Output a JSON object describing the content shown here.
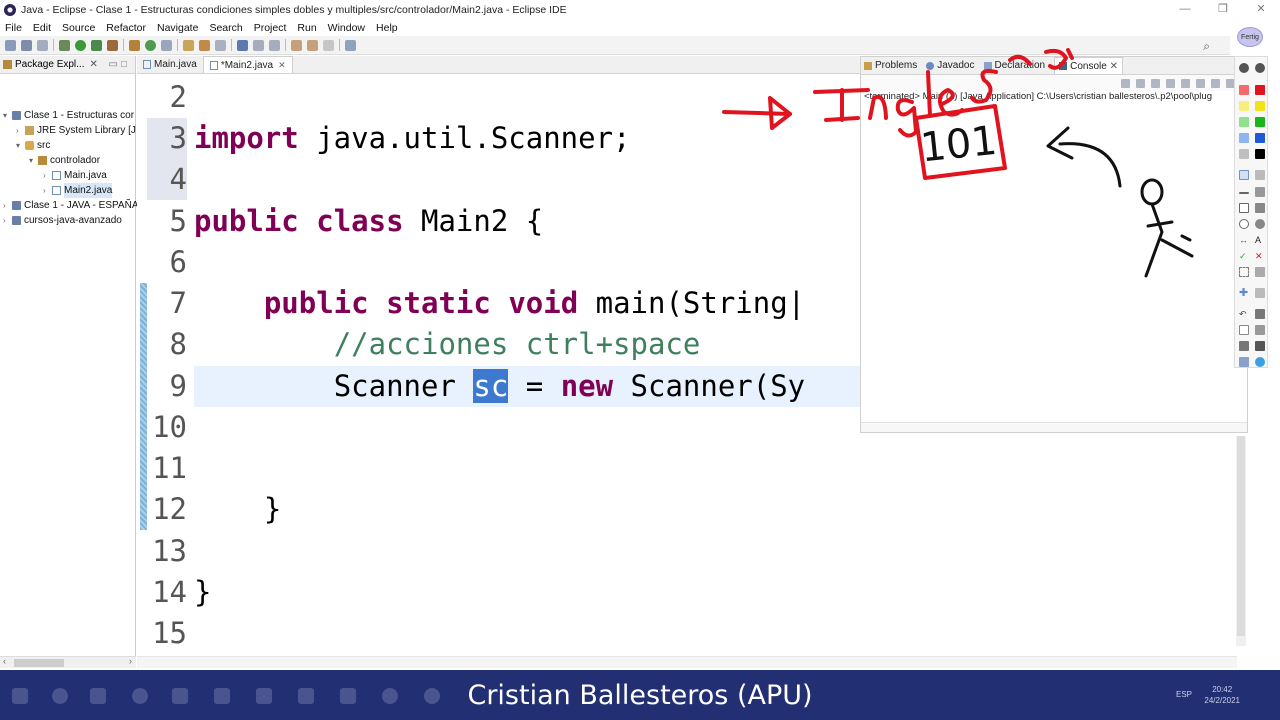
{
  "window": {
    "title": "Java - Eclipse - Clase 1 - Estructuras condiciones simples dobles y multiples/src/controlador/Main2.java - Eclipse IDE",
    "controls": [
      "—",
      "❐",
      "✕"
    ]
  },
  "menu": [
    "File",
    "Edit",
    "Source",
    "Refactor",
    "Navigate",
    "Search",
    "Project",
    "Run",
    "Window",
    "Help"
  ],
  "package_explorer": {
    "title": "Package Expl...",
    "tree": [
      {
        "label": "Clase 1 - Estructuras cor",
        "icon": "project"
      },
      {
        "label": "JRE System Library [J",
        "icon": "library"
      },
      {
        "label": "src",
        "icon": "source-folder"
      },
      {
        "label": "controlador",
        "icon": "package"
      },
      {
        "label": "Main.java",
        "icon": "java-file"
      },
      {
        "label": "Main2.java",
        "icon": "java-file"
      },
      {
        "label": "Clase 1 - JAVA - ESPAÑA",
        "icon": "project"
      },
      {
        "label": "cursos-java-avanzado",
        "icon": "project"
      }
    ]
  },
  "editor": {
    "tabs": [
      {
        "label": "Main.java",
        "active": false
      },
      {
        "label": "*Main2.java",
        "active": true
      }
    ],
    "line_numbers": [
      "2",
      "3",
      "4",
      "5",
      "6",
      "7",
      "8",
      "9",
      "10",
      "11",
      "12",
      "13",
      "14",
      "15"
    ],
    "code": {
      "l3_kw": "import",
      "l3_rest": " java.util.Scanner;",
      "l5_kw1": "public",
      "l5_kw2": "class",
      "l5_rest": " Main2 {",
      "l7_indent": "    ",
      "l7_kw1": "public",
      "l7_kw2": "static",
      "l7_kw3": "void",
      "l7_rest": " main(String|",
      "l8_indent": "        ",
      "l8_comment": "//acciones ctrl+space",
      "l9_indent": "        ",
      "l9_type": "Scanner ",
      "l9_sel": "sc",
      "l9_mid": " = ",
      "l9_kw": "new",
      "l9_rest": " Scanner(Sy",
      "l12": "    }",
      "l14": "}"
    }
  },
  "console": {
    "tabs": [
      "Problems",
      "Javadoc",
      "Declaration",
      "Console"
    ],
    "terminated_text": "<terminated> Main (1) [Java Application] C:\\Users\\cristian ballesteros\\.p2\\pool\\plug"
  },
  "pen_tool": {
    "label": "Fertig"
  },
  "annotations": {
    "box_text": "101",
    "handwriting": "Ingles"
  },
  "taskbar": {
    "caption": "Cristian Ballesteros (APU)",
    "language": "ESP",
    "time": "20:42",
    "date": "24/2/2021"
  },
  "colors": {
    "keyword": "#7f0055",
    "comment": "#3f7f5f",
    "selection": "#3c79cf",
    "ink_red": "#e0141e",
    "taskbar": "#232f73"
  }
}
